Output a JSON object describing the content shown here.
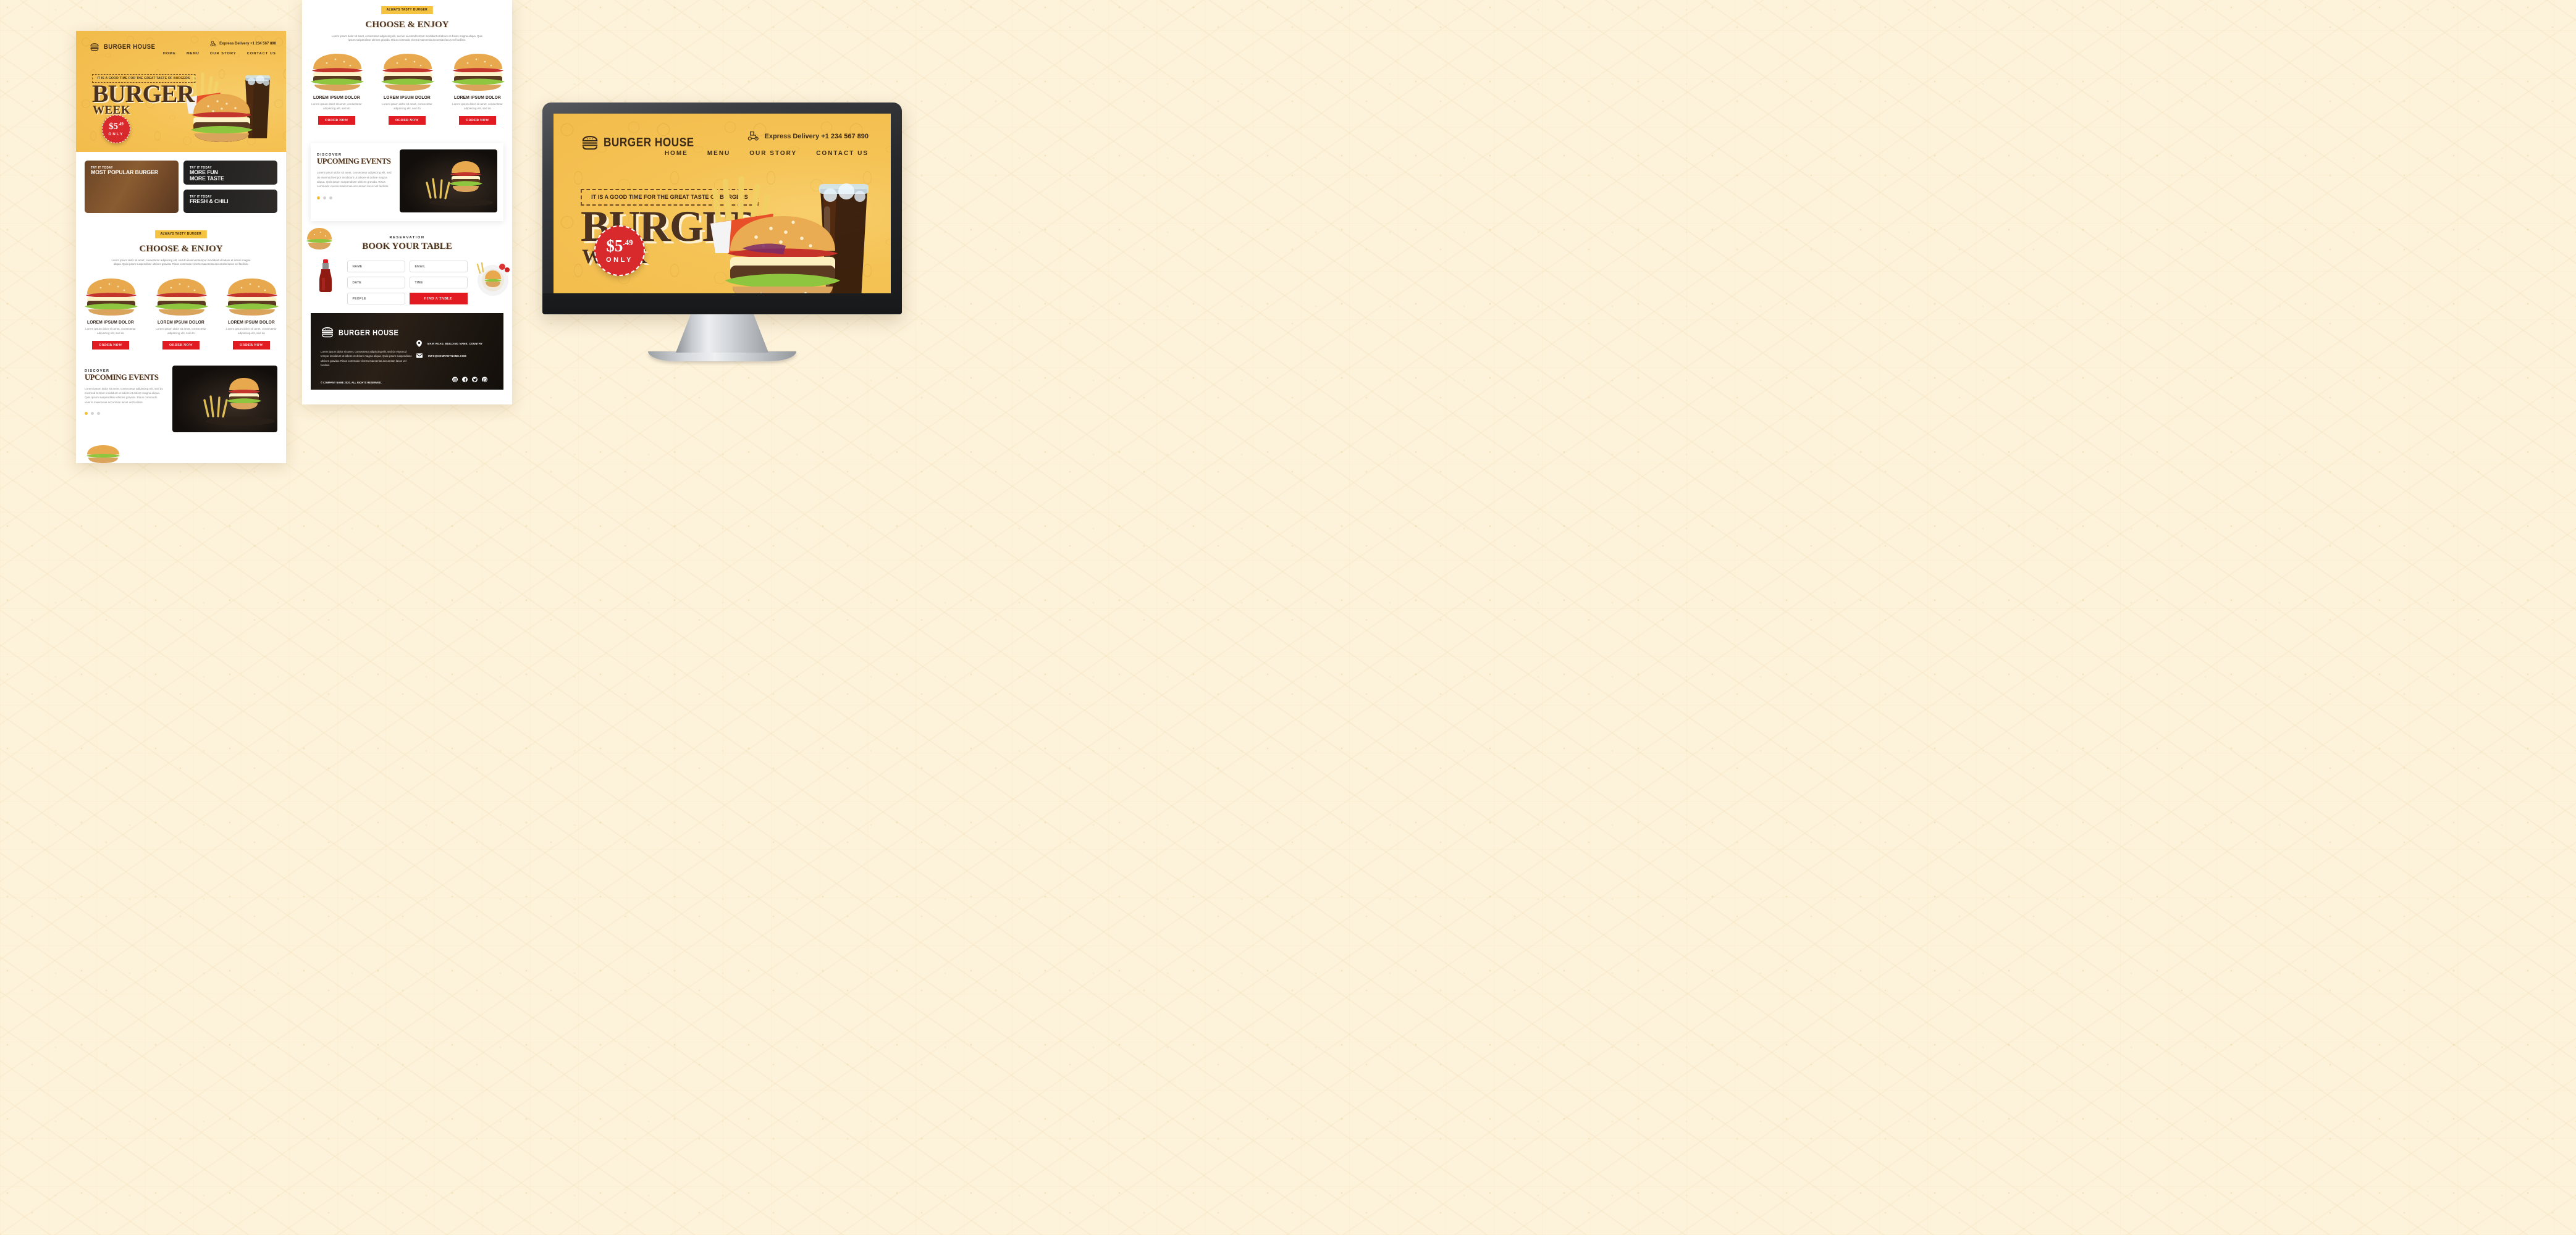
{
  "brand": {
    "name": "BURGER HOUSE",
    "logo_icon": "burger-logo-icon"
  },
  "header": {
    "delivery_icon": "scooter-delivery-icon",
    "delivery_text": "Express Delivery +1 234 567 890",
    "nav": [
      "HOME",
      "MENU",
      "OUR STORY",
      "CONTACT US"
    ]
  },
  "hero": {
    "tagline": "IT IS A GOOD TIME FOR THE GREAT TASTE OF BURGERS",
    "headline": "BURGER",
    "subheadline": "WEEK",
    "badge_price": "$5",
    "badge_cents": ".49",
    "badge_only": "ONLY"
  },
  "promos": [
    {
      "kicker": "TRY IT TODAY",
      "title": "MOST POPULAR BURGER"
    },
    {
      "kicker": "TRY IT TODAY",
      "title_line1": "MORE FUN",
      "title_line2": "MORE TASTE"
    },
    {
      "kicker": "TRY IT TODAY",
      "title": "FRESH & CHILI"
    }
  ],
  "choose": {
    "pill": "ALWAYS TASTY BURGER",
    "heading": "CHOOSE & ENJOY",
    "description": "Lorem ipsum dolor sit amet, consectetur adipiscing elit, sed do eiusmod tempor incididunt ut labore et dolore magna aliqua. Quis ipsum suspendisse ultrices gravida. Risus commodo viverra maecenas accumsan lacus vel facilisis.",
    "cards": [
      {
        "title": "LOREM IPSUM DOLOR",
        "text": "Lorem ipsum dolor sit amet, consectetur adipiscing elit, sed do",
        "button": "ORDER NOW"
      },
      {
        "title": "LOREM IPSUM DOLOR",
        "text": "Lorem ipsum dolor sit amet, consectetur adipiscing elit, sed do",
        "button": "ORDER NOW"
      },
      {
        "title": "LOREM IPSUM DOLOR",
        "text": "Lorem ipsum dolor sit amet, consectetur adipiscing elit, sed do",
        "button": "ORDER NOW"
      }
    ]
  },
  "events": {
    "kicker": "DISCOVER",
    "heading": "UPCOMING EVENTS",
    "text": "Lorem ipsum dolor sit amet, consectetur adipiscing elit, sed do eiusmod tempor incididunt ut labore et dolore magna aliqua. Quis ipsum suspendisse ultrices gravida. Risus commodo viverra maecenas accumsan lacus vel facilisis.",
    "dots": 3,
    "active_dot": 1
  },
  "reservation": {
    "kicker": "RESERVATION",
    "heading": "BOOK YOUR TABLE",
    "fields": [
      {
        "name": "name-field",
        "placeholder": "NAME"
      },
      {
        "name": "email-field",
        "placeholder": "EMAIL"
      },
      {
        "name": "date-field",
        "placeholder": "DATE"
      },
      {
        "name": "time-field",
        "placeholder": "TIME"
      },
      {
        "name": "people-field",
        "placeholder": "PEOPLE"
      }
    ],
    "submit": "FIND A TABLE"
  },
  "footer": {
    "brand": "BURGER HOUSE",
    "description": "Lorem ipsum dolor sit amet, consectetur adipiscing elit, sed do eiusmod tempor incididunt ut labore et dolore magna aliqua. Quis ipsum suspendisse ultrices gravida. Risus commodo viverra maecenas accumsan lacus vel facilisis.",
    "address": "MAIN ROAD, BUILDING NAME, COUNTRY",
    "email": "INFO@COMPANYNAME.COM",
    "copyright": "© COMPANY NAME 2020. ALL RIGHTS RESERVED.",
    "socials": [
      "instagram-icon",
      "facebook-icon",
      "twitter-icon",
      "whatsapp-icon"
    ]
  },
  "colors": {
    "yellow": "#f5c355",
    "pill_yellow": "#f5c33f",
    "brown": "#4a3120",
    "red": "#e21b22",
    "badge_red": "#d8292d",
    "cream_bg": "#fdf2da",
    "dark": "#1f1b17"
  }
}
